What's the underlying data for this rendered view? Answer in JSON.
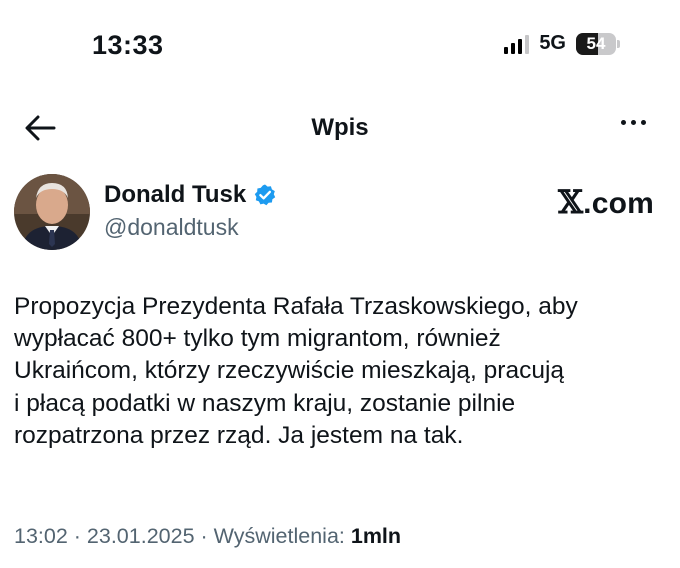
{
  "status_bar": {
    "time": "13:33",
    "network": "5G",
    "battery_level": "54",
    "battery_fraction": 0.54,
    "signal_bars_filled": 3,
    "signal_bars_total": 4
  },
  "nav": {
    "back_icon": "arrow-left-icon",
    "title": "Wpis",
    "more_icon": "more-horizontal-icon"
  },
  "author": {
    "name": "Donald Tusk",
    "handle": "@donaldtusk",
    "verified": true,
    "verified_color": "#1d9bf0"
  },
  "watermark": {
    "x_glyph": "𝕏",
    "domain": ".com"
  },
  "tweet": {
    "text_lines": [
      "Propozycja Prezydenta Rafała Trzaskowskiego, aby",
      "wypłacać 800+ tylko tym migrantom, również",
      "Ukraińcom, którzy rzeczywiście mieszkają, pracują",
      "i płacą podatki w naszym kraju, zostanie pilnie",
      "rozpatrzona przez rząd. Ja jestem na tak."
    ]
  },
  "meta": {
    "time": "13:02",
    "separator": " · ",
    "date": "23.01.2025",
    "views_label": "Wyświetlenia: ",
    "views_value": "1mln"
  },
  "colors": {
    "text": "#0f1419",
    "secondary": "#536471",
    "verified": "#1d9bf0"
  }
}
